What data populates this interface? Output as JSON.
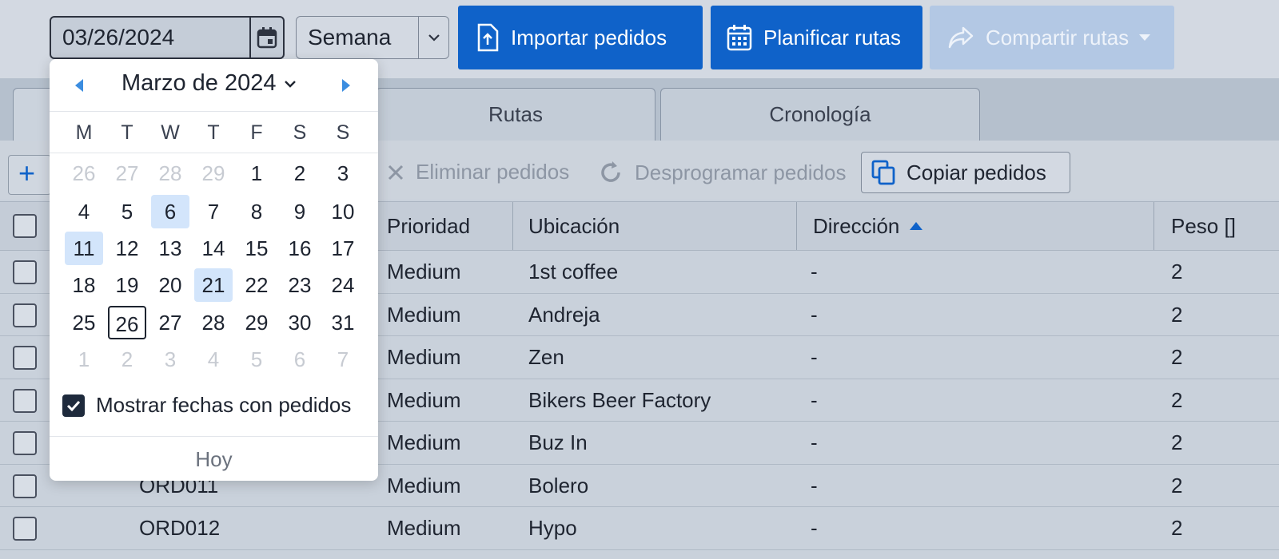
{
  "toolbar": {
    "date_value": "03/26/2024",
    "calendar_icon": "calendar-icon",
    "period": "Semana",
    "import_label": "Importar pedidos",
    "plan_label": "Planificar rutas",
    "share_label": "Compartir rutas",
    "colors": {
      "primary": "#0f62c9",
      "disabled": "#b3c8e4"
    }
  },
  "tabs": [
    {
      "label": ""
    },
    {
      "label": "Rutas"
    },
    {
      "label": "Cronología"
    }
  ],
  "actions": {
    "add": "+",
    "delete": "Eliminar pedidos",
    "unschedule": "Desprogramar pedidos",
    "copy": "Copiar pedidos"
  },
  "table": {
    "headers": {
      "priority": "Prioridad",
      "location": "Ubicación",
      "address": "Dirección",
      "weight": "Peso []"
    },
    "rows": [
      {
        "id": "",
        "priority": "Medium",
        "location": "1st coffee",
        "address": "-",
        "weight": "2"
      },
      {
        "id": "",
        "priority": "Medium",
        "location": "Andreja",
        "address": "-",
        "weight": "2"
      },
      {
        "id": "",
        "priority": "Medium",
        "location": "Zen",
        "address": "-",
        "weight": "2"
      },
      {
        "id": "",
        "priority": "Medium",
        "location": "Bikers Beer Factory",
        "address": "-",
        "weight": "2"
      },
      {
        "id": "",
        "priority": "Medium",
        "location": "Buz In",
        "address": "-",
        "weight": "2"
      },
      {
        "id": "ORD011",
        "priority": "Medium",
        "location": "Bolero",
        "address": "-",
        "weight": "2"
      },
      {
        "id": "ORD012",
        "priority": "Medium",
        "location": "Hypo",
        "address": "-",
        "weight": "2"
      }
    ]
  },
  "calendar": {
    "month_label": "Marzo de 2024",
    "weekdays": [
      "M",
      "T",
      "W",
      "T",
      "F",
      "S",
      "S"
    ],
    "weeks": [
      [
        {
          "d": "26",
          "m": true
        },
        {
          "d": "27",
          "m": true
        },
        {
          "d": "28",
          "m": true
        },
        {
          "d": "29",
          "m": true
        },
        {
          "d": "1"
        },
        {
          "d": "2"
        },
        {
          "d": "3"
        }
      ],
      [
        {
          "d": "4"
        },
        {
          "d": "5"
        },
        {
          "d": "6",
          "hl": true
        },
        {
          "d": "7"
        },
        {
          "d": "8"
        },
        {
          "d": "9"
        },
        {
          "d": "10"
        }
      ],
      [
        {
          "d": "11",
          "hl": true
        },
        {
          "d": "12"
        },
        {
          "d": "13"
        },
        {
          "d": "14"
        },
        {
          "d": "15"
        },
        {
          "d": "16"
        },
        {
          "d": "17"
        }
      ],
      [
        {
          "d": "18"
        },
        {
          "d": "19"
        },
        {
          "d": "20"
        },
        {
          "d": "21",
          "hl": true
        },
        {
          "d": "22"
        },
        {
          "d": "23"
        },
        {
          "d": "24"
        }
      ],
      [
        {
          "d": "25"
        },
        {
          "d": "26",
          "today": true
        },
        {
          "d": "27"
        },
        {
          "d": "28"
        },
        {
          "d": "29"
        },
        {
          "d": "30"
        },
        {
          "d": "31"
        }
      ],
      [
        {
          "d": "1",
          "m": true
        },
        {
          "d": "2",
          "m": true
        },
        {
          "d": "3",
          "m": true
        },
        {
          "d": "4",
          "m": true
        },
        {
          "d": "5",
          "m": true
        },
        {
          "d": "6",
          "m": true
        },
        {
          "d": "7",
          "m": true
        }
      ]
    ],
    "show_dates_label": "Mostrar fechas con pedidos",
    "show_dates_checked": true,
    "today_label": "Hoy",
    "colors": {
      "highlight": "#d3e5fb",
      "nav_arrow": "#3b8de0"
    }
  }
}
